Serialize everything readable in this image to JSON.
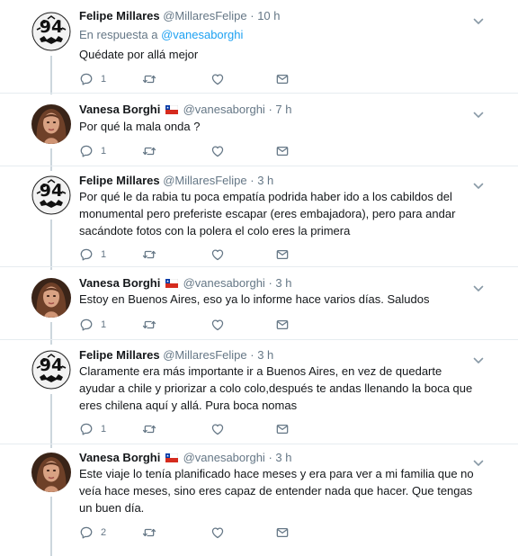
{
  "tweets": [
    {
      "name": "Felipe Millares",
      "handle": "@MillaresFelipe",
      "dot": "·",
      "time": "10 h",
      "avatar": "logo-94-avatar",
      "reply_prefix": "En respuesta a",
      "reply_to": "@vanesaborghi",
      "text": "Quédate por allá mejor",
      "replies": "1",
      "retweets": "",
      "likes": ""
    },
    {
      "name": "Vanesa Borghi",
      "flag": "chile-flag-icon",
      "handle": "@vanesaborghi",
      "dot": "·",
      "time": "7 h",
      "avatar": "woman-photo-avatar",
      "text": "Por qué la mala onda ?",
      "replies": "1",
      "retweets": "",
      "likes": ""
    },
    {
      "name": "Felipe Millares",
      "handle": "@MillaresFelipe",
      "dot": "·",
      "time": "3 h",
      "avatar": "logo-94-avatar",
      "text": "Por qué le da rabia tu poca empatía podrida haber ido a los cabildos del monumental pero preferiste escapar (eres embajadora), pero para andar sacándote fotos con la polera el colo eres la primera",
      "replies": "1",
      "retweets": "",
      "likes": ""
    },
    {
      "name": "Vanesa Borghi",
      "flag": "chile-flag-icon",
      "handle": "@vanesaborghi",
      "dot": "·",
      "time": "3 h",
      "avatar": "woman-photo-avatar",
      "text": "Estoy en Buenos Aires, eso ya lo informe hace varios días. Saludos",
      "replies": "1",
      "retweets": "",
      "likes": ""
    },
    {
      "name": "Felipe Millares",
      "handle": "@MillaresFelipe",
      "dot": "·",
      "time": "3 h",
      "avatar": "logo-94-avatar",
      "text": "Claramente era más importante ir a Buenos Aires, en vez de quedarte ayudar a chile y priorizar a colo colo,después te andas llenando la boca que eres chilena aquí y allá. Pura boca nomas",
      "replies": "1",
      "retweets": "",
      "likes": ""
    },
    {
      "name": "Vanesa Borghi",
      "flag": "chile-flag-icon",
      "handle": "@vanesaborghi",
      "dot": "·",
      "time": "3 h",
      "avatar": "woman-photo-avatar",
      "text": "Este viaje lo tenía planificado hace meses y era para ver a mi familia que no veía hace meses, sino eres capaz de entender  nada que hacer. Que tengas un buen día.",
      "replies": "2",
      "retweets": "",
      "likes": ""
    }
  ],
  "icons": {
    "reply": "reply-icon",
    "retweet": "retweet-icon",
    "like": "heart-icon",
    "message": "envelope-icon",
    "more": "chevron-down-icon"
  },
  "colors": {
    "name": "#14171a",
    "secondary": "#657786",
    "link": "#1da1f2",
    "divider": "#e6ecf0",
    "thread_line": "#ccd6dd"
  }
}
